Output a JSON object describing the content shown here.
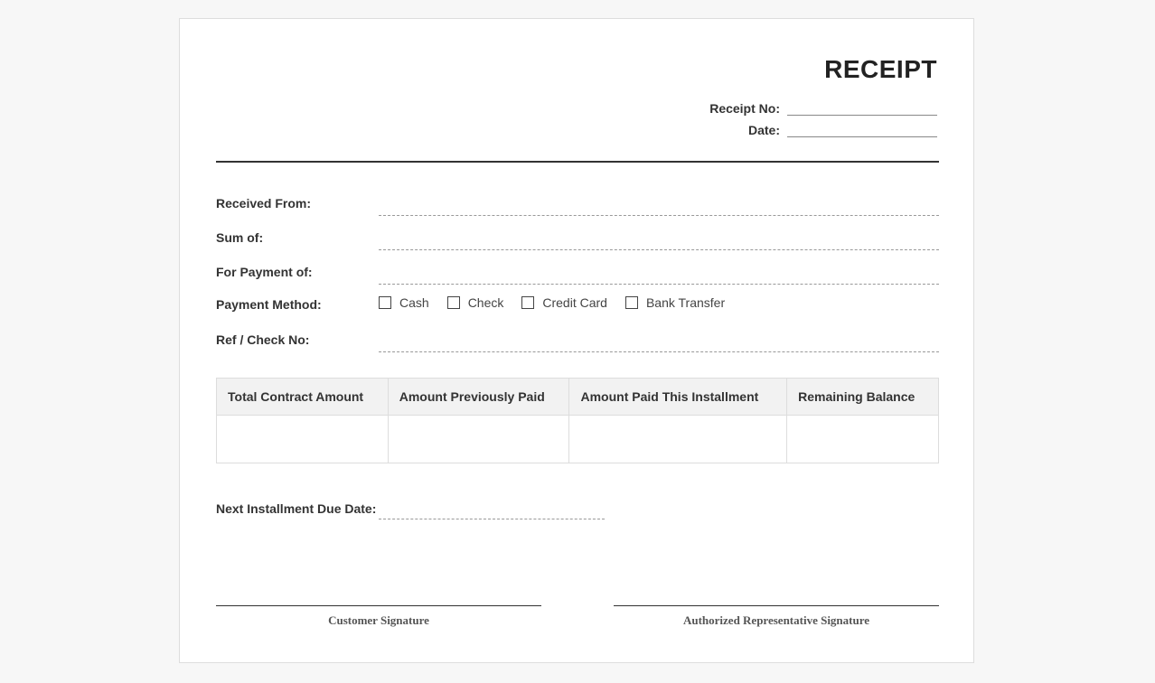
{
  "receipt": {
    "title": "RECEIPT",
    "receipt_no_label": "Receipt No:",
    "date_label": "Date:"
  },
  "fields": {
    "received_from_label": "Received From:",
    "sum_of_label": "Sum of:",
    "for_payment_label": "For Payment of:",
    "payment_method_label": "Payment Method:",
    "ref_check_label": "Ref / Check No:"
  },
  "payment_methods": [
    "Cash",
    "Check",
    "Credit Card",
    "Bank Transfer"
  ],
  "table": {
    "headers": [
      "Total Contract Amount",
      "Amount Previously Paid",
      "Amount Paid This Installment",
      "Remaining Balance"
    ]
  },
  "next_installment_label": "Next Installment Due Date:",
  "signatures": {
    "customer_label": "Customer Signature",
    "representative_label": "Authorized Representative Signature"
  }
}
